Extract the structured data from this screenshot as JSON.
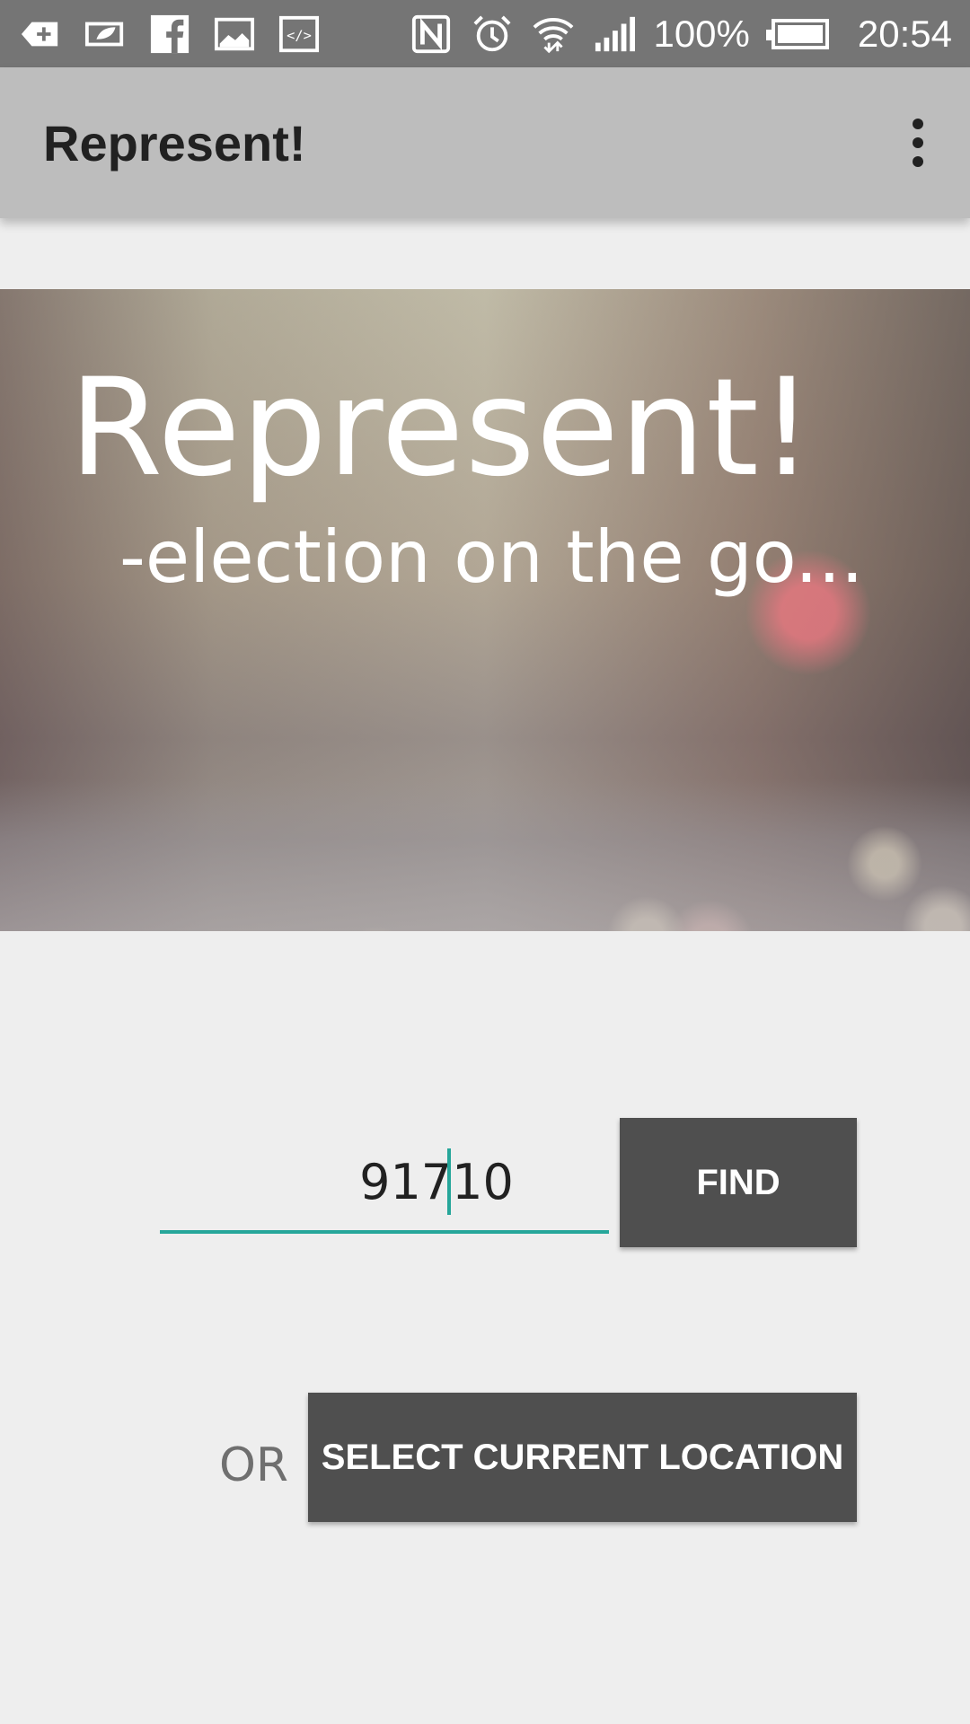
{
  "status_bar": {
    "battery_text": "100%",
    "time": "20:54",
    "icons": [
      "add-notification-icon",
      "eco-battery-icon",
      "facebook-icon",
      "gallery-icon",
      "code-icon",
      "nfc-icon",
      "alarm-icon",
      "wifi-icon",
      "signal-icon",
      "battery-icon"
    ]
  },
  "app_bar": {
    "title": "Represent!",
    "overflow_icon": "more-vert-icon"
  },
  "hero": {
    "title": "Represent!",
    "subtitle": "-election on the go..."
  },
  "zip_search": {
    "value": "91710",
    "find_label": "FIND"
  },
  "location": {
    "or_label": "OR",
    "button_label": "SELECT CURRENT LOCATION"
  },
  "colors": {
    "accent": "#26a69a",
    "button_bg": "#4f4f4f",
    "app_bar": "#bdbdbd",
    "status_bar": "#757575"
  }
}
